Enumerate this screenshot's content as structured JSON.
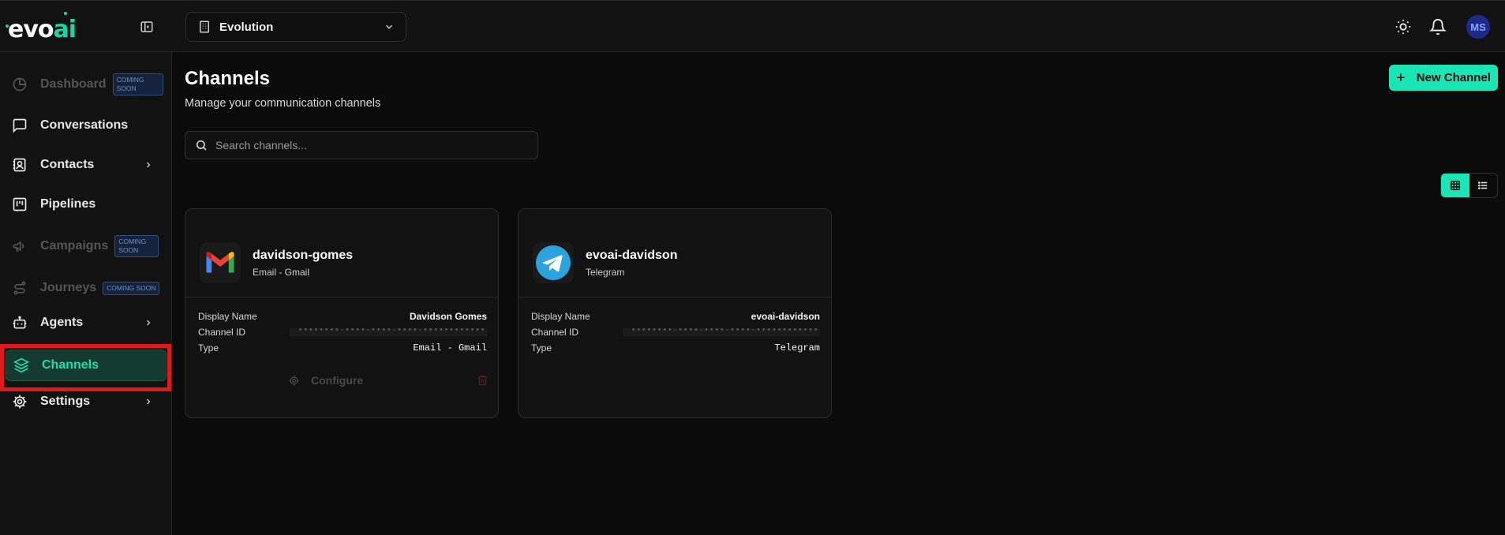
{
  "app": {
    "logo": {
      "prefix": "evo",
      "suffix": "ai"
    },
    "workspace": {
      "name": "Evolution"
    },
    "user": {
      "initials": "MS"
    }
  },
  "sidebar": {
    "items": [
      {
        "label": "Dashboard",
        "icon": "pie-chart-icon",
        "badge": "COMING SOON",
        "disabled": true
      },
      {
        "label": "Conversations",
        "icon": "message-square-icon"
      },
      {
        "label": "Contacts",
        "icon": "contact-book-icon",
        "has_submenu": true
      },
      {
        "label": "Pipelines",
        "icon": "kanban-icon"
      },
      {
        "label": "Campaigns",
        "icon": "megaphone-icon",
        "badge": "COMING SOON",
        "disabled": true
      },
      {
        "label": "Journeys",
        "icon": "route-icon",
        "badge": "COMING SOON",
        "disabled": true
      },
      {
        "label": "Agents",
        "icon": "bot-icon",
        "has_submenu": true
      },
      {
        "label": "Channels",
        "icon": "layers-icon",
        "active": true
      },
      {
        "label": "Settings",
        "icon": "gear-icon",
        "has_submenu": true
      }
    ]
  },
  "page": {
    "title": "Channels",
    "subtitle": "Manage your communication channels",
    "new_button": "New Channel",
    "search_placeholder": "Search channels..."
  },
  "channels": [
    {
      "name": "davidson-gomes",
      "type_label": "Email - Gmail",
      "icon": "gmail-icon",
      "rows": [
        {
          "key": "Display Name",
          "value": "Davidson Gomes"
        },
        {
          "key": "Channel ID",
          "value": "••••••••-••••-••••-••••-••••••••••••"
        },
        {
          "key": "Type",
          "value": "Email - Gmail"
        }
      ],
      "configure_label": "Configure"
    },
    {
      "name": "evoai-davidson",
      "type_label": "Telegram",
      "icon": "telegram-icon",
      "rows": [
        {
          "key": "Display Name",
          "value": "evoai-davidson"
        },
        {
          "key": "Channel ID",
          "value": "••••••••-••••-••••-••••-••••••••••••"
        },
        {
          "key": "Type",
          "value": "Telegram"
        }
      ]
    }
  ],
  "colors": {
    "accent": "#19e6b4",
    "highlight": "#e01a1a",
    "avatar_bg": "#1e2a8a"
  }
}
